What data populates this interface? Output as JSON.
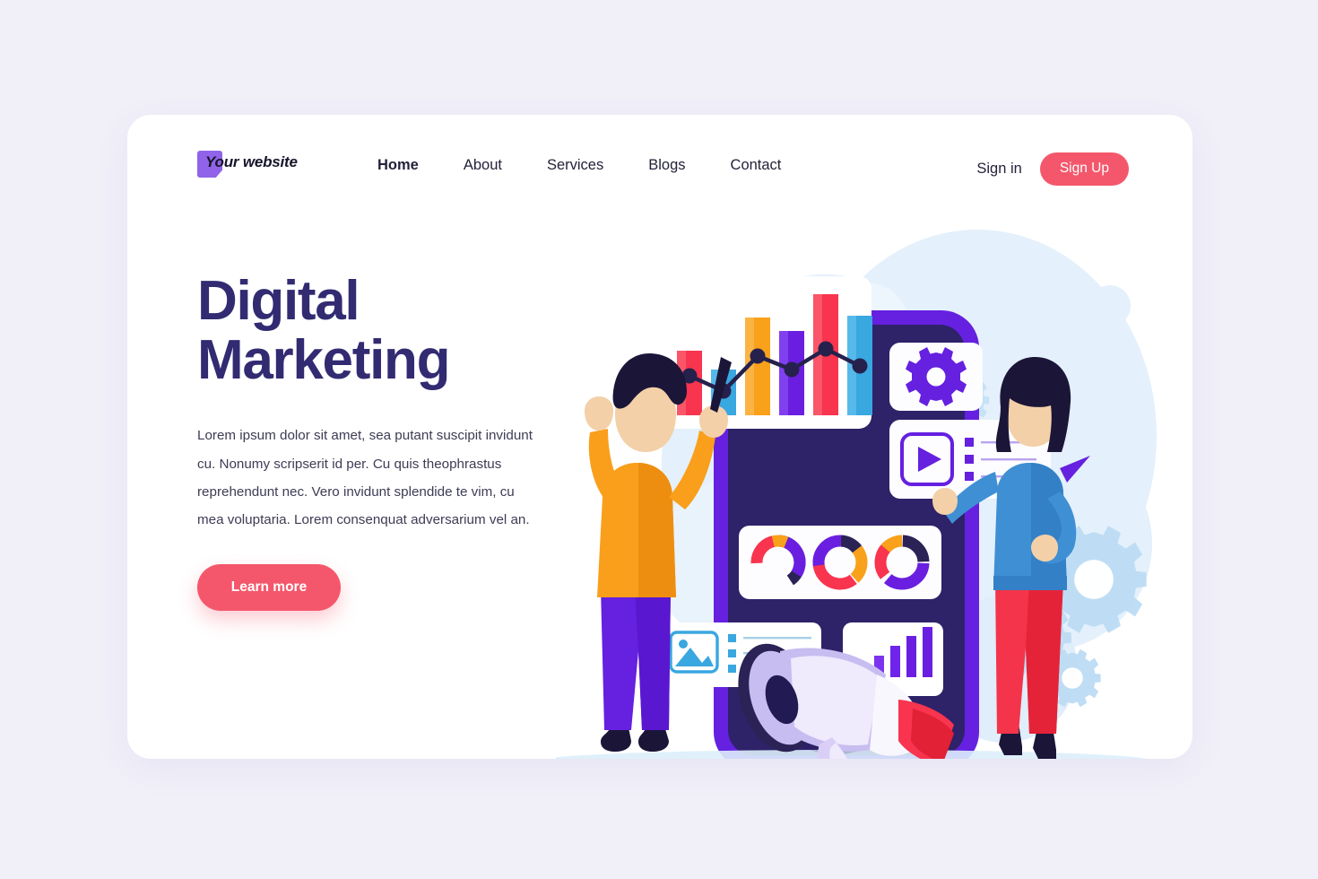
{
  "brand": {
    "name": "Your website",
    "mark_icon": "logo-mark",
    "mark_color": "#9063e8"
  },
  "nav": {
    "items": [
      {
        "label": "Home",
        "active": true
      },
      {
        "label": "About",
        "active": false
      },
      {
        "label": "Services",
        "active": false
      },
      {
        "label": "Blogs",
        "active": false
      },
      {
        "label": "Contact",
        "active": false
      }
    ],
    "signin_label": "Sign in",
    "signup_label": "Sign Up"
  },
  "hero": {
    "title_line1": "Digital",
    "title_line2": "Marketing",
    "paragraph": "Lorem ipsum dolor sit amet, sea putant suscipit invidunt cu. Nonumy scripserit id per. Cu quis theophrastus reprehendunt nec. Vero invidunt splendide te vim, cu mea voluptaria. Lorem consenquat adversarium vel an.",
    "cta_label": "Learn more"
  },
  "colors": {
    "page_background": "#f1f0f9",
    "card_background": "#ffffff",
    "heading": "#322b72",
    "accent_red": "#f4576b",
    "accent_purple": "#6520e0",
    "phone_screen": "#2e2269",
    "body_text": "#3d3c55",
    "chart_red": "#f8344e",
    "chart_orange": "#f9a11b",
    "chart_blue": "#39a7e0",
    "chart_violet": "#6a1fe0",
    "chart_navy": "#2b2255",
    "pale_blue": "#deeefb"
  },
  "illustration": {
    "name": "digital-marketing-illustration",
    "phone": {
      "name": "smartphone-mockup"
    },
    "cards": [
      {
        "name": "bar-chart-card",
        "icon": "bar-chart-with-line-icon"
      },
      {
        "name": "settings-card",
        "icon": "gear-icon"
      },
      {
        "name": "video-playlist-card",
        "icon": "play-button-icon",
        "list_rows": 3
      },
      {
        "name": "donut-charts-card",
        "icon": "donut-chart-icon",
        "donut_count": 3
      },
      {
        "name": "image-list-card",
        "icon": "image-icon",
        "list_rows": 3
      },
      {
        "name": "growth-bars-card",
        "icon": "ascending-bars-icon",
        "bar_count": 5
      }
    ],
    "characters": [
      {
        "name": "man-character",
        "shirt": "#f99f1c",
        "pants": "#6520e0",
        "prop": "stylus"
      },
      {
        "name": "woman-character",
        "shirt": "#3f8fd4",
        "pants": "#f4344a",
        "prop": "phone"
      }
    ],
    "decorations": [
      {
        "name": "megaphone-icon"
      },
      {
        "name": "paper-plane-icon",
        "count": 2
      },
      {
        "name": "gear-decoration-icon",
        "count": 3
      },
      {
        "name": "blue-blob-decoration"
      },
      {
        "name": "dashed-path-decoration"
      }
    ]
  },
  "chart_data": [
    {
      "type": "bar",
      "name": "hero-bar-chart",
      "title": "",
      "categories": [
        "1",
        "2",
        "3",
        "4",
        "5",
        "6"
      ],
      "values": [
        46,
        32,
        70,
        58,
        88,
        64
      ],
      "bar_colors": [
        "#f8344e",
        "#39a7e0",
        "#f9a11b",
        "#6a1fe0",
        "#f8344e",
        "#39a7e0"
      ],
      "overlay_series": {
        "name": "trend",
        "type": "line",
        "values": [
          38,
          26,
          54,
          42,
          64,
          44
        ],
        "color": "#2b2255"
      },
      "xlabel": "",
      "ylabel": "",
      "ylim": [
        0,
        100
      ],
      "grid": false,
      "legend": "none"
    },
    {
      "type": "pie",
      "name": "donut-chart-1",
      "labels": [
        "navy",
        "red",
        "orange",
        "violet"
      ],
      "values": [
        40,
        22,
        10,
        28
      ],
      "colors": [
        "#2b2255",
        "#f8344e",
        "#f9a11b",
        "#6a1fe0"
      ],
      "title": ""
    },
    {
      "type": "pie",
      "name": "donut-chart-2",
      "labels": [
        "navy",
        "orange",
        "red",
        "violet"
      ],
      "values": [
        14,
        24,
        34,
        28
      ],
      "colors": [
        "#2b2255",
        "#f9a11b",
        "#f8344e",
        "#6a1fe0"
      ],
      "title": ""
    },
    {
      "type": "pie",
      "name": "donut-chart-3",
      "labels": [
        "navy",
        "violet",
        "red",
        "orange"
      ],
      "values": [
        24,
        36,
        26,
        14
      ],
      "colors": [
        "#2b2255",
        "#6a1fe0",
        "#f8344e",
        "#f9a11b"
      ],
      "title": ""
    },
    {
      "type": "bar",
      "name": "growth-bars-chart",
      "categories": [
        "1",
        "2",
        "3",
        "4",
        "5"
      ],
      "values": [
        18,
        40,
        58,
        76,
        96
      ],
      "bar_colors": [
        "#6a1fe0",
        "#6a1fe0",
        "#6a1fe0",
        "#6a1fe0",
        "#6a1fe0"
      ],
      "xlabel": "",
      "ylabel": "",
      "ylim": [
        0,
        100
      ],
      "grid": false,
      "legend": "none"
    }
  ]
}
